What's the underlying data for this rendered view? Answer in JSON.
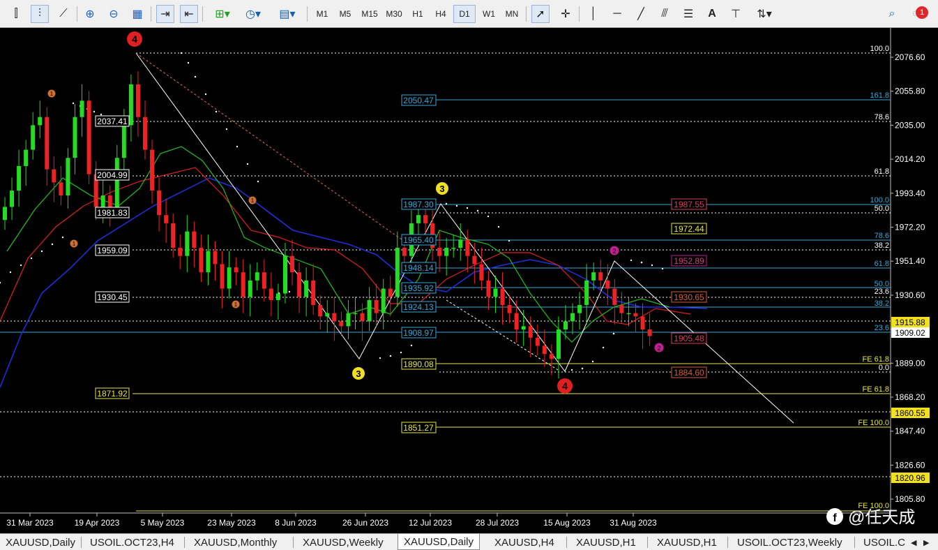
{
  "toolbar": {
    "timeframes": [
      "M1",
      "M5",
      "M15",
      "M30",
      "H1",
      "H4",
      "D1",
      "W1",
      "MN"
    ],
    "active_timeframe": "D1",
    "text_tool": "A",
    "notification_count": "1"
  },
  "chart_data": {
    "type": "candlestick",
    "symbol": "XAUUSD",
    "timeframe": "Daily",
    "y_ticks": [
      "2076.60",
      "2055.80",
      "2035.00",
      "2014.20",
      "1993.40",
      "1972.20",
      "1951.40",
      "1930.60",
      "1909.80",
      "1889.00",
      "1868.20",
      "1847.40",
      "1826.60",
      "1805.80"
    ],
    "x_ticks": [
      "31 Mar 2023",
      "19 Apr 2023",
      "5 May 2023",
      "23 May 2023",
      "8 Jun 2023",
      "26 Jun 2023",
      "12 Jul 2023",
      "28 Jul 2023",
      "15 Aug 2023",
      "31 Aug 2023"
    ],
    "current_price": "1909.02",
    "right_price_labels": [
      "1915.88",
      "1860.55",
      "1820.96"
    ],
    "level_labels_left": [
      "2037.41",
      "2004.99",
      "1981.83",
      "1959.09",
      "1930.45",
      "1871.92"
    ],
    "level_labels_mid": [
      "2050.47",
      "1987.30",
      "1965.40",
      "1948.14",
      "1935.92",
      "1924.13",
      "1908.97",
      "1890.08",
      "1851.27"
    ],
    "level_labels_red": [
      "1987.55",
      "1952.89",
      "1930.65",
      "1905.48",
      "1884.60"
    ],
    "level_label_yellow": "1972.44",
    "fib_labels": [
      "100.0",
      "161.8",
      "78.6",
      "61.8",
      "100.0",
      "50.0",
      "78.6",
      "38.2",
      "61.8",
      "50.0",
      "23.6",
      "38.2",
      "23.6",
      "FE 61.8",
      "0.0",
      "FE 61.8",
      "FE 100.0",
      "FE 100.0"
    ],
    "wave_labels": {
      "big4": "4",
      "big3": "3",
      "small1": "1",
      "small2": "2"
    },
    "series": [
      {
        "name": "candles",
        "values": [
          1985,
          1995,
          2010,
          2020,
          2035,
          2040,
          2008,
          2000,
          1992,
          2015,
          2040,
          2050,
          2005,
          1985,
          1992,
          1985,
          2015,
          2035,
          2060,
          2040,
          2020,
          1995,
          1980,
          1975,
          1960,
          1955,
          1970,
          1960,
          1945,
          1958,
          1950,
          1935,
          1948,
          1945,
          1930,
          1940,
          1945,
          1935,
          1928,
          1932,
          1955,
          1945,
          1930,
          1940,
          1925,
          1918,
          1920,
          1915,
          1912,
          1920,
          1920,
          1915,
          1928,
          1920,
          1935,
          1930,
          1960,
          1955,
          1975,
          1980,
          1975,
          1960,
          1955,
          1960,
          1960,
          1965,
          1955,
          1950,
          1940,
          1930,
          1935,
          1925,
          1920,
          1910,
          1912,
          1905,
          1900,
          1895,
          1892,
          1910,
          1915,
          1920,
          1925,
          1940,
          1945,
          1940,
          1935,
          1925,
          1920,
          1920,
          1918,
          1910,
          1906
        ]
      }
    ],
    "watermark": "@任天成"
  },
  "tabs": {
    "items": [
      "XAUUSD,Daily",
      "USOIL.OCT23,H4",
      "XAUUSD,Monthly",
      "XAUUSD,Weekly",
      "XAUUSD,Daily",
      "XAUUSD,H4",
      "XAUUSD,H1",
      "XAUUSD,H1",
      "USOIL.OCT23,Weekly",
      "USOIL.C"
    ],
    "active_index": 4
  }
}
